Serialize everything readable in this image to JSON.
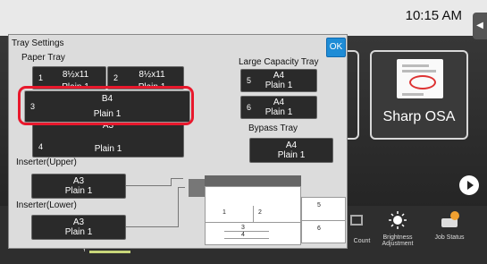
{
  "status_bar": {
    "clock": "10:15 AM"
  },
  "home": {
    "osa_tile_label": "Sharp OSA",
    "bottom_items": {
      "counter": "Count",
      "brightness": "Brightness Adjustment",
      "job_status": "Job Status"
    },
    "toner_label": "Y"
  },
  "dialog": {
    "title": "Tray Settings",
    "ok_label": "OK",
    "paper_tray_label": "Paper Tray",
    "large_capacity_label": "Large Capacity Tray",
    "bypass_label": "Bypass Tray",
    "inserter_upper_label": "Inserter(Upper)",
    "inserter_lower_label": "Inserter(Lower)",
    "trays": [
      {
        "num": "1",
        "size": "8½x11",
        "type": "Plain 1"
      },
      {
        "num": "2",
        "size": "8½x11",
        "type": "Plain 1"
      },
      {
        "num": "3",
        "size": "B4",
        "type": "Plain 1"
      },
      {
        "num": "4",
        "size": "A3",
        "type": "Plain 1"
      }
    ],
    "lct": [
      {
        "num": "5",
        "size": "A4",
        "type": "Plain 1"
      },
      {
        "num": "6",
        "size": "A4",
        "type": "Plain 1"
      }
    ],
    "bypass": {
      "size": "A4",
      "type": "Plain 1"
    },
    "inserter_upper": {
      "size": "A3",
      "type": "Plain 1"
    },
    "inserter_lower": {
      "size": "A3",
      "type": "Plain 1"
    },
    "machine_tray_numbers": [
      "1",
      "2",
      "3",
      "4",
      "5",
      "6"
    ],
    "selected_tray": "3"
  },
  "colors": {
    "ok_button": "#1e8cd6",
    "selection_ring": "#e8182c"
  }
}
